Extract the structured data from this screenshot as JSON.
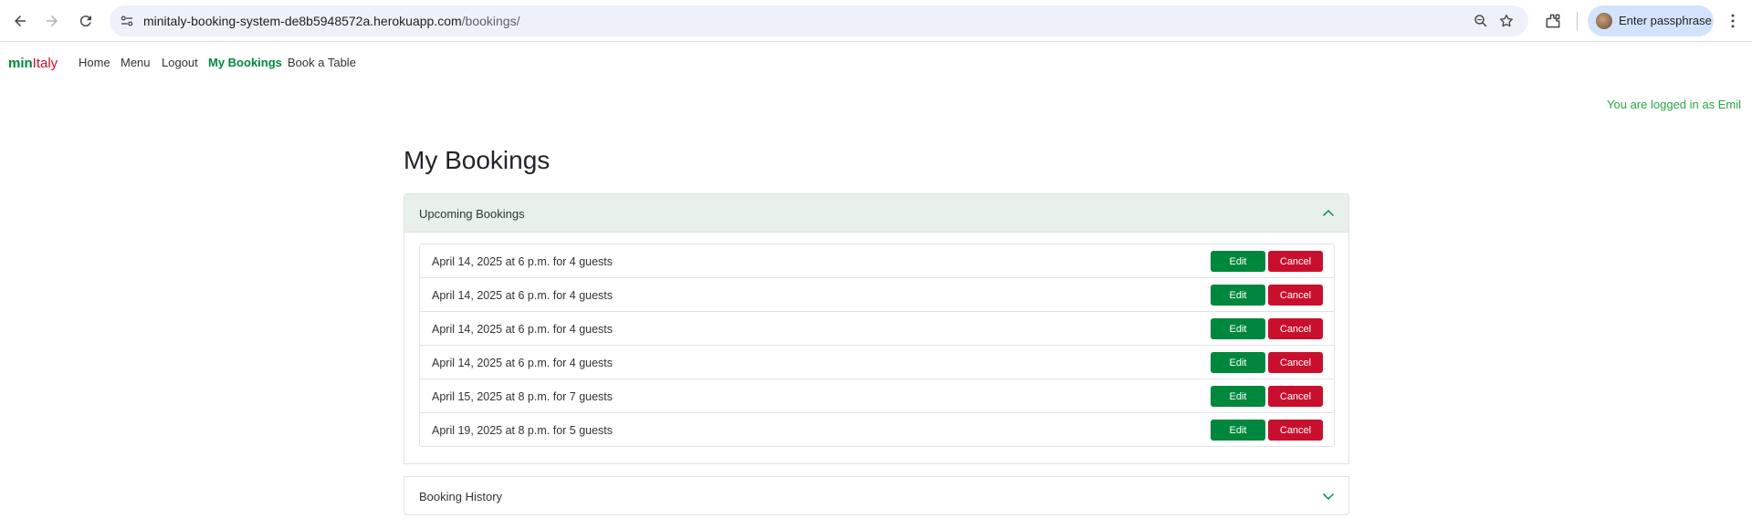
{
  "browser": {
    "url_host": "minitaly-booking-system-de8b5948572a.herokuapp.com",
    "url_path": "/bookings/",
    "profile_label": "Enter passphrase"
  },
  "site": {
    "brand_part1": "min",
    "brand_part2": "Italy",
    "nav": {
      "home": "Home",
      "menu": "Menu",
      "logout": "Logout",
      "my_bookings": "My Bookings",
      "book_table": "Book a Table"
    },
    "login_status": "You are logged in as Emil"
  },
  "main": {
    "title": "My Bookings",
    "upcoming": {
      "label": "Upcoming Bookings",
      "bookings": [
        {
          "text": "April 14, 2025 at 6 p.m. for 4 guests",
          "edit": "Edit",
          "cancel": "Cancel"
        },
        {
          "text": "April 14, 2025 at 6 p.m. for 4 guests",
          "edit": "Edit",
          "cancel": "Cancel"
        },
        {
          "text": "April 14, 2025 at 6 p.m. for 4 guests",
          "edit": "Edit",
          "cancel": "Cancel"
        },
        {
          "text": "April 14, 2025 at 6 p.m. for 4 guests",
          "edit": "Edit",
          "cancel": "Cancel"
        },
        {
          "text": "April 15, 2025 at 8 p.m. for 7 guests",
          "edit": "Edit",
          "cancel": "Cancel"
        },
        {
          "text": "April 19, 2025 at 8 p.m. for 5 guests",
          "edit": "Edit",
          "cancel": "Cancel"
        }
      ]
    },
    "history": {
      "label": "Booking History"
    }
  },
  "colors": {
    "brand_green": "#00873e",
    "brand_red": "#c8102e",
    "accordion_active_bg": "#e7f1e9",
    "login_status": "#28a745"
  },
  "icons": [
    "back-arrow-icon",
    "forward-arrow-icon",
    "reload-icon",
    "site-info-icon",
    "zoom-icon",
    "bookmark-star-icon",
    "extensions-icon",
    "kebab-menu-icon",
    "chevron-up-icon",
    "chevron-down-icon"
  ]
}
